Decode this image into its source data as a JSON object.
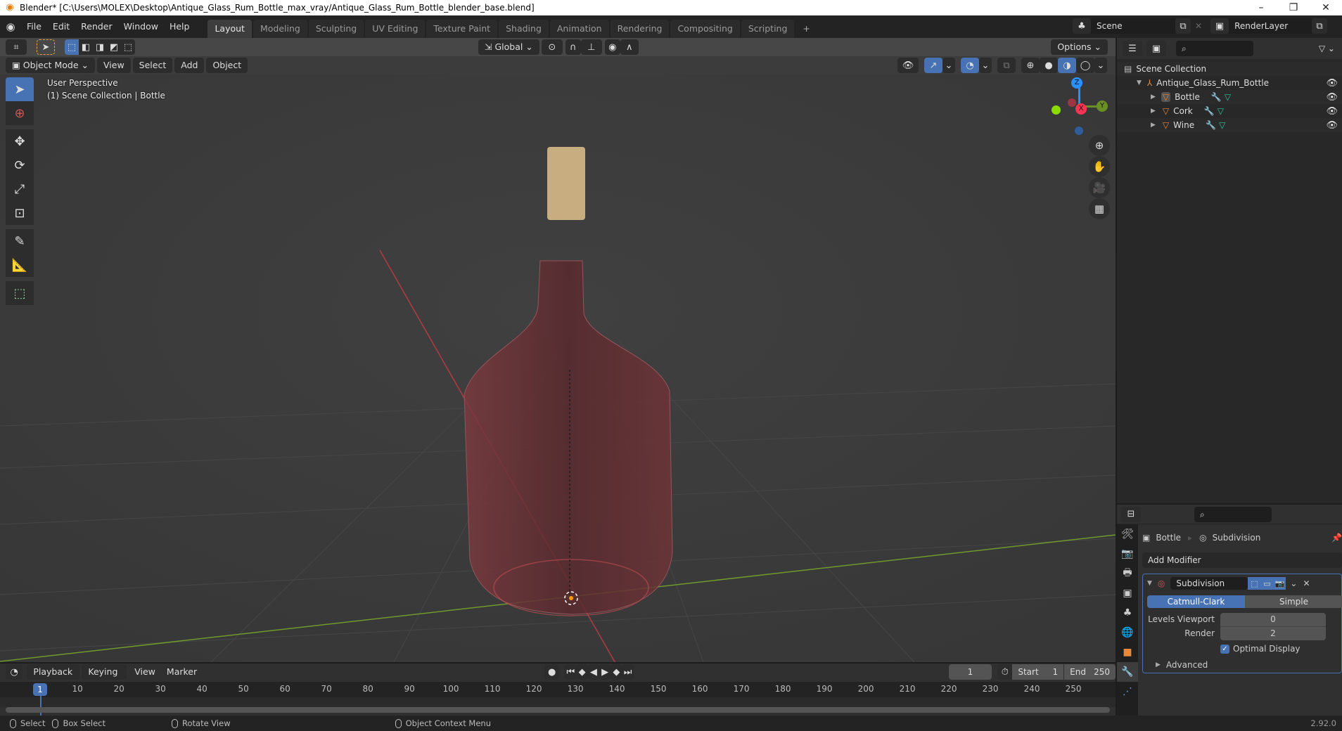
{
  "window": {
    "title": "Blender* [C:\\Users\\MOLEX\\Desktop\\Antique_Glass_Rum_Bottle_max_vray/Antique_Glass_Rum_Bottle_blender_base.blend]",
    "controls": [
      "–",
      "❐",
      "✕"
    ]
  },
  "menu": [
    "File",
    "Edit",
    "Render",
    "Window",
    "Help"
  ],
  "workspaces": [
    {
      "label": "Layout",
      "active": true
    },
    {
      "label": "Modeling"
    },
    {
      "label": "Sculpting"
    },
    {
      "label": "UV Editing"
    },
    {
      "label": "Texture Paint"
    },
    {
      "label": "Shading"
    },
    {
      "label": "Animation"
    },
    {
      "label": "Rendering"
    },
    {
      "label": "Compositing"
    },
    {
      "label": "Scripting"
    }
  ],
  "add_workspace": "+",
  "scene": {
    "name": "Scene",
    "render_layer": "RenderLayer"
  },
  "viewport": {
    "transform_orientation": "Global",
    "options_label": "Options",
    "mode": "Object Mode",
    "menus": [
      "View",
      "Select",
      "Add",
      "Object"
    ],
    "overlay_line1": "User Perspective",
    "overlay_line2": "(1) Scene Collection | Bottle",
    "gizmo": {
      "x": "X",
      "y": "Y",
      "z": "Z"
    }
  },
  "outliner": {
    "root": "Scene Collection",
    "collection": "Antique_Glass_Rum_Bottle",
    "objects": [
      {
        "name": "Bottle",
        "selected": true
      },
      {
        "name": "Cork"
      },
      {
        "name": "Wine"
      }
    ]
  },
  "properties": {
    "breadcrumb_object": "Bottle",
    "breadcrumb_modifier": "Subdivision",
    "add_modifier": "Add Modifier",
    "modifier_name": "Subdivision",
    "algorithm_options": [
      "Catmull-Clark",
      "Simple"
    ],
    "algorithm_selected": "Catmull-Clark",
    "levels_viewport_label": "Levels Viewport",
    "levels_viewport": "0",
    "render_label": "Render",
    "render_levels": "2",
    "optimal_display_label": "Optimal Display",
    "optimal_display": true,
    "advanced_label": "Advanced"
  },
  "timeline": {
    "menus": [
      "Playback",
      "Keying",
      "View",
      "Marker"
    ],
    "current_frame": "1",
    "start_label": "Start",
    "start": "1",
    "end_label": "End",
    "end": "250",
    "ticks": [
      "10",
      "20",
      "30",
      "40",
      "50",
      "60",
      "70",
      "80",
      "90",
      "100",
      "110",
      "120",
      "130",
      "140",
      "150",
      "160",
      "170",
      "180",
      "190",
      "200",
      "210",
      "220",
      "230",
      "240",
      "250"
    ],
    "playhead": "1"
  },
  "statusbar": {
    "select": "Select",
    "box_select": "Box Select",
    "rotate_view": "Rotate View",
    "context_menu": "Object Context Menu",
    "version": "2.92.0"
  },
  "colors": {
    "accent": "#4772b3",
    "x_axis": "#ff3352",
    "y_axis": "#8bdc00",
    "z_axis": "#2890ff",
    "object": "#e8893b"
  }
}
